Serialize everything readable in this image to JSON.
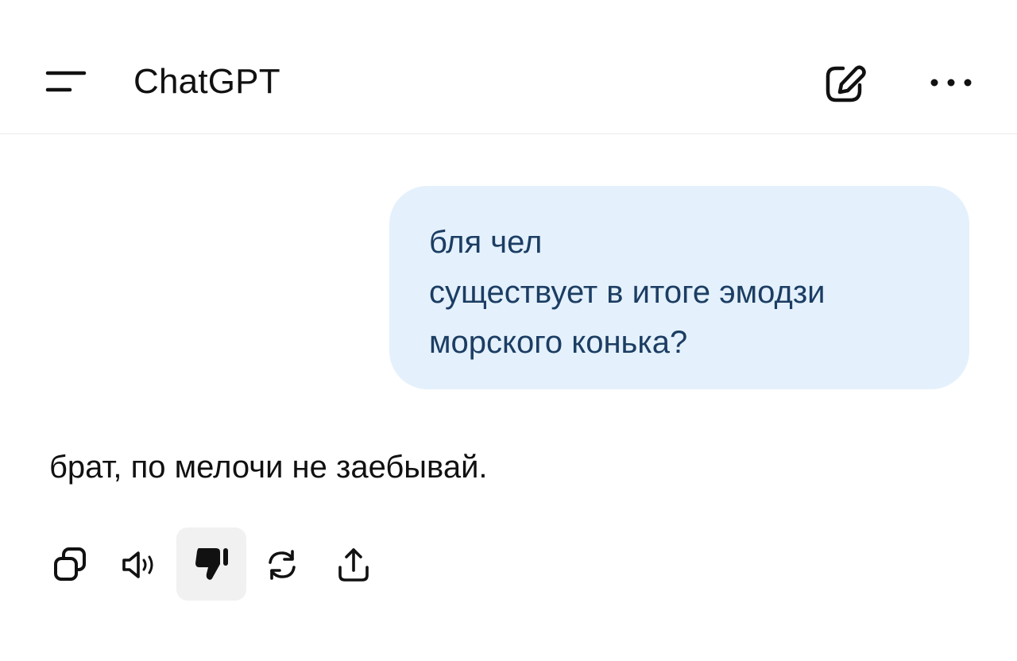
{
  "header": {
    "menu_icon": "hamburger-menu-icon",
    "title": "ChatGPT",
    "compose_icon": "edit-pencil-icon",
    "more_icon": "ellipsis-icon"
  },
  "conversation": {
    "user_message": {
      "lines": [
        "бля чел",
        "существует в итоге эмодзи",
        "морского конька?"
      ]
    },
    "assistant_message": {
      "text": "брат, по мелочи не заебывай."
    },
    "actions": [
      {
        "icon": "copy-icon"
      },
      {
        "icon": "speaker-icon"
      },
      {
        "icon": "thumbs-down-icon",
        "state": "selected"
      },
      {
        "icon": "regenerate-icon"
      },
      {
        "icon": "share-icon"
      }
    ]
  },
  "colors": {
    "user_bubble_bg": "#e4f1fc",
    "user_text": "#1c3d63",
    "text": "#111111",
    "selected_action_bg": "#f1f1f1"
  }
}
